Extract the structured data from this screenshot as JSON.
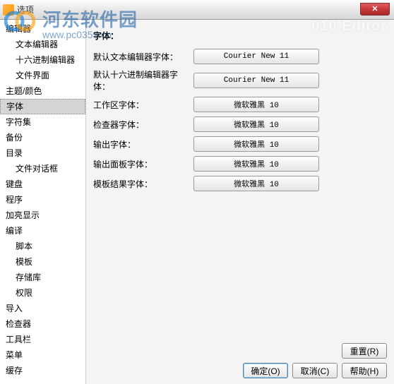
{
  "window": {
    "title": "选项",
    "close_glyph": "✕"
  },
  "watermark": {
    "text1": "河东软件园",
    "text2": "www.pc0359.cn",
    "brand": "010 Editor"
  },
  "sidebar": {
    "items": [
      {
        "label": "编辑器",
        "child": false
      },
      {
        "label": "文本编辑器",
        "child": true
      },
      {
        "label": "十六进制编辑器",
        "child": true
      },
      {
        "label": "文件界面",
        "child": true
      },
      {
        "label": "主题/颜色",
        "child": false
      },
      {
        "label": "字体",
        "child": false,
        "selected": true
      },
      {
        "label": "字符集",
        "child": false
      },
      {
        "label": "备份",
        "child": false
      },
      {
        "label": "目录",
        "child": false
      },
      {
        "label": "文件对话框",
        "child": true
      },
      {
        "label": "键盘",
        "child": false
      },
      {
        "label": "程序",
        "child": false
      },
      {
        "label": "加亮显示",
        "child": false
      },
      {
        "label": "编译",
        "child": false
      },
      {
        "label": "脚本",
        "child": true
      },
      {
        "label": "模板",
        "child": true
      },
      {
        "label": "存储库",
        "child": true
      },
      {
        "label": "权限",
        "child": true
      },
      {
        "label": "导入",
        "child": false
      },
      {
        "label": "检查器",
        "child": false
      },
      {
        "label": "工具栏",
        "child": false
      },
      {
        "label": "菜单",
        "child": false
      },
      {
        "label": "缓存",
        "child": false
      }
    ]
  },
  "main": {
    "section_title": "字体：",
    "rows": [
      {
        "label": "默认文本编辑器字体：",
        "value": "Courier New 11"
      },
      {
        "label": "默认十六进制编辑器字体：",
        "value": "Courier New 11"
      },
      {
        "label": "工作区字体：",
        "value": "微软雅黑 10"
      },
      {
        "label": "检查器字体：",
        "value": "微软雅黑 10"
      },
      {
        "label": "输出字体：",
        "value": "微软雅黑 10"
      },
      {
        "label": "输出面板字体：",
        "value": "微软雅黑 10"
      },
      {
        "label": "模板结果字体：",
        "value": "微软雅黑 10"
      }
    ]
  },
  "buttons": {
    "reset": "重置(R)",
    "ok": "确定(O)",
    "cancel": "取消(C)",
    "help": "帮助(H)"
  }
}
